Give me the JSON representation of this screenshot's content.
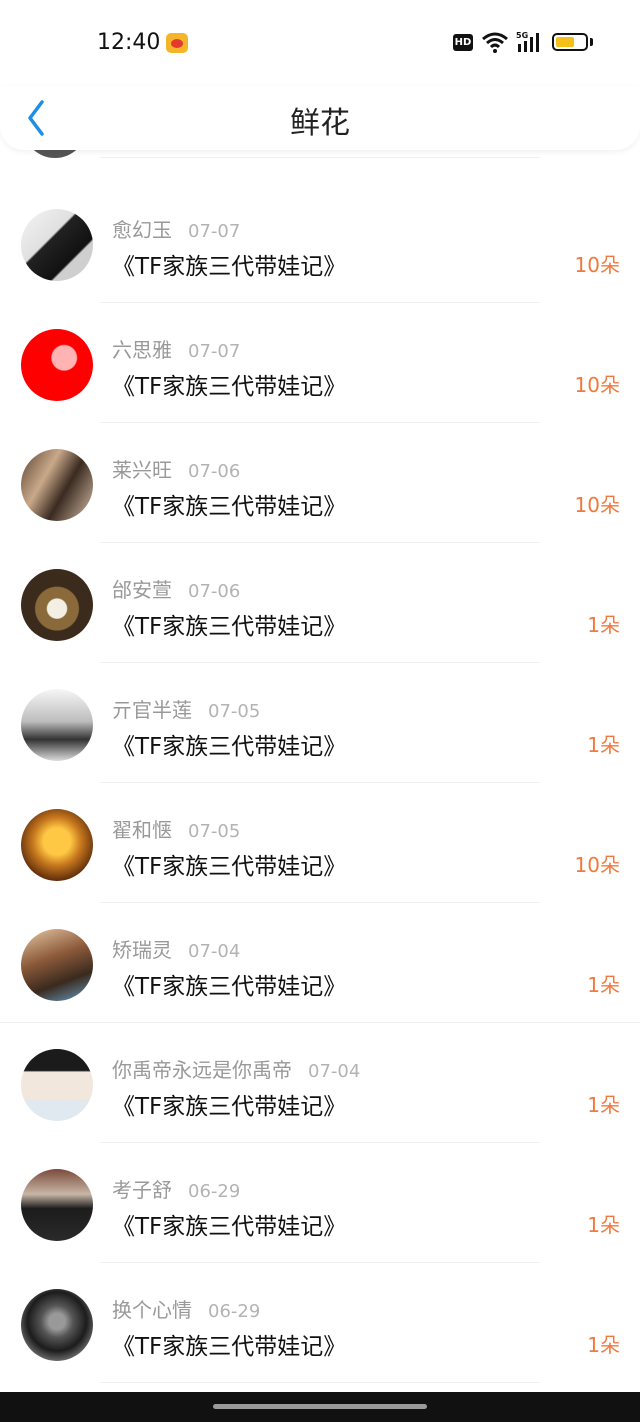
{
  "status_bar": {
    "time": "12:40",
    "hd": "HD"
  },
  "nav": {
    "title": "鲜花"
  },
  "rows": [
    {
      "name": "愈幻玉",
      "date": "07-07",
      "title": "《TF家族三代带娃记》",
      "count": "10朵"
    },
    {
      "name": "六思雅",
      "date": "07-07",
      "title": "《TF家族三代带娃记》",
      "count": "10朵"
    },
    {
      "name": "莱兴旺",
      "date": "07-06",
      "title": "《TF家族三代带娃记》",
      "count": "10朵"
    },
    {
      "name": "邰安萱",
      "date": "07-06",
      "title": "《TF家族三代带娃记》",
      "count": "1朵"
    },
    {
      "name": "亓官半莲",
      "date": "07-05",
      "title": "《TF家族三代带娃记》",
      "count": "1朵"
    },
    {
      "name": "翟和惬",
      "date": "07-05",
      "title": "《TF家族三代带娃记》",
      "count": "10朵"
    },
    {
      "name": "矫瑞灵",
      "date": "07-04",
      "title": "《TF家族三代带娃记》",
      "count": "1朵"
    },
    {
      "name": "你禹帝永远是你禹帝",
      "date": "07-04",
      "title": "《TF家族三代带娃记》",
      "count": "1朵"
    },
    {
      "name": "考子舒",
      "date": "06-29",
      "title": "《TF家族三代带娃记》",
      "count": "1朵"
    },
    {
      "name": "换个心情",
      "date": "06-29",
      "title": "《TF家族三代带娃记》",
      "count": "1朵"
    }
  ]
}
